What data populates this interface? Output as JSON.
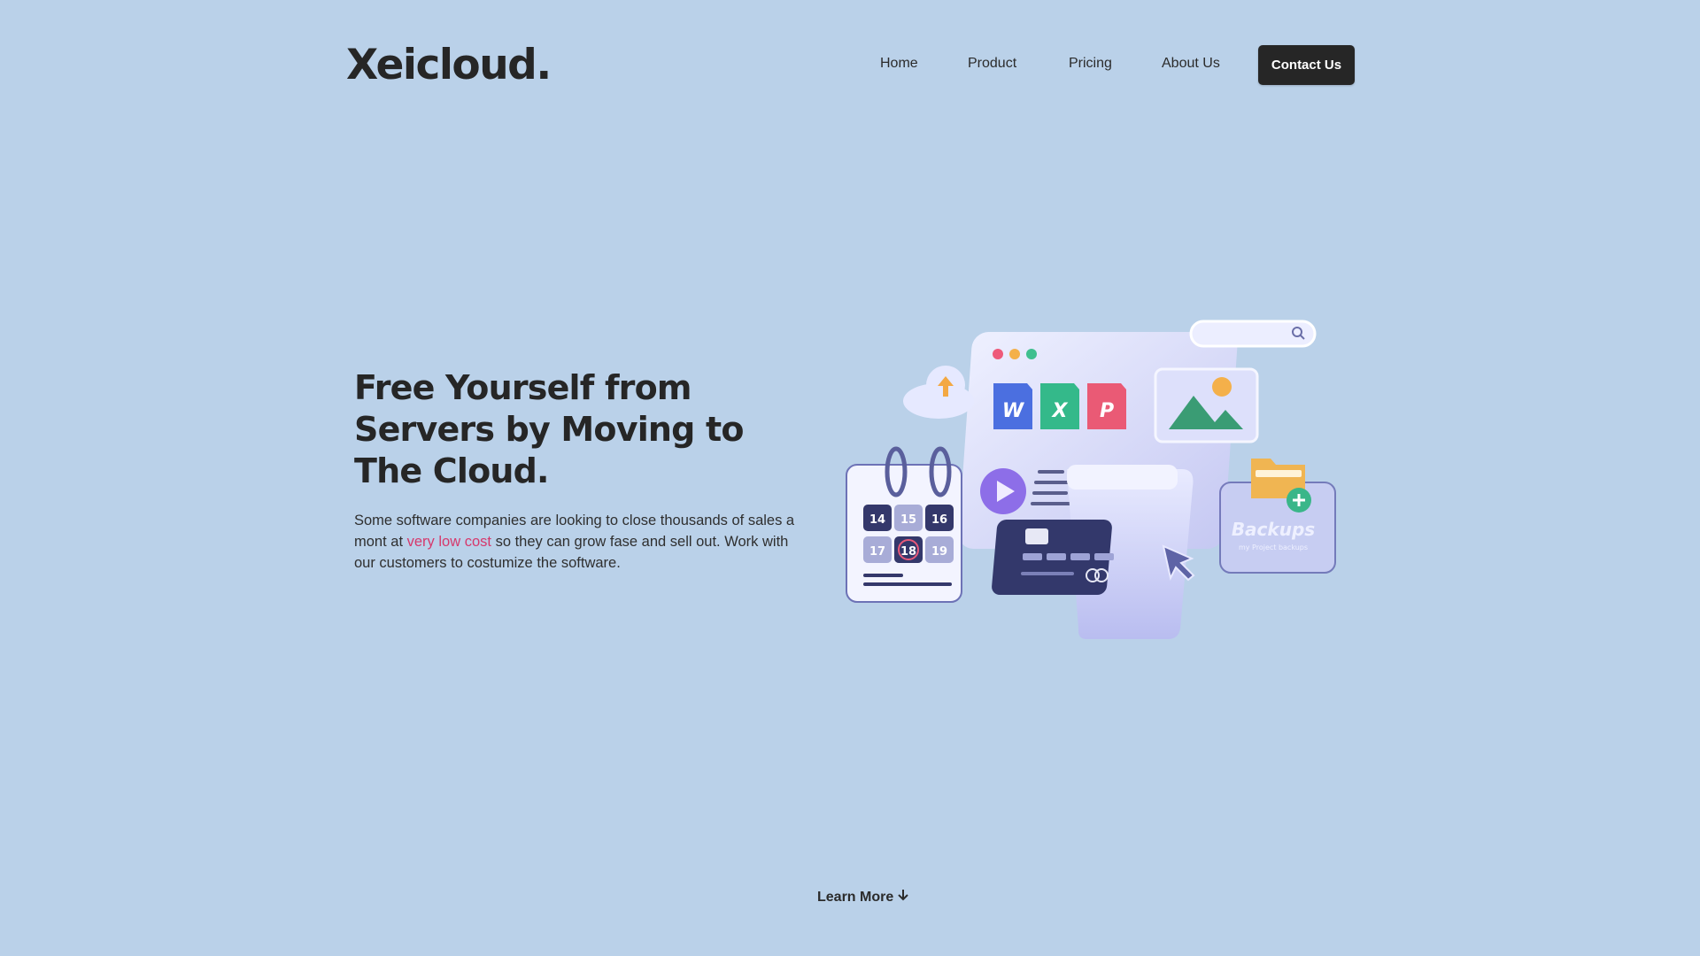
{
  "brand": {
    "logo": "Xeicloud."
  },
  "nav": {
    "items": [
      "Home",
      "Product",
      "Pricing",
      "About Us"
    ],
    "cta": "Contact Us"
  },
  "hero": {
    "title": "Free Yourself from Servers by Moving to The Cloud.",
    "text_before": "Some software companies are looking to close thousands of sales a mont at ",
    "highlight": "very low cost",
    "text_after": " so they can grow fase and sell out. Work with our customers to costumize the software."
  },
  "illustration": {
    "doc_icons": [
      "W",
      "X",
      "P"
    ],
    "calendar_days": [
      "14",
      "15",
      "16",
      "17",
      "18",
      "19"
    ],
    "backups_label": "Backups",
    "backups_sub": "my Project backups"
  },
  "footer_cta": {
    "label": "Learn More",
    "icon": "arrow-down-icon"
  },
  "colors": {
    "background": "#bad1e9",
    "dark": "#262626",
    "highlight": "#d6386c"
  }
}
